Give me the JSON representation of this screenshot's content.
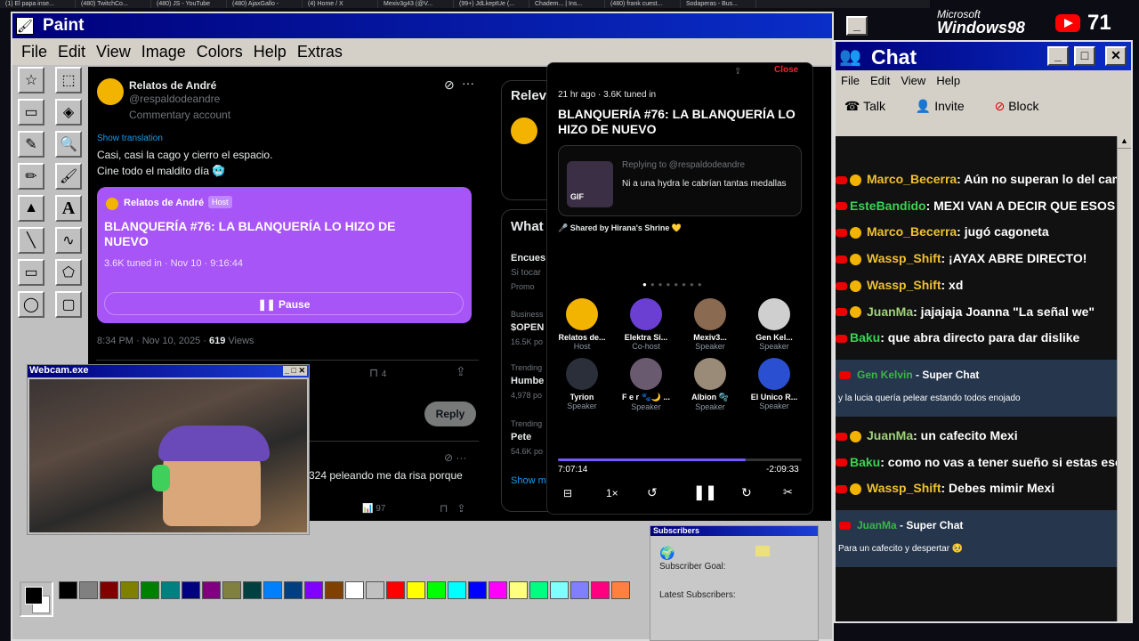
{
  "browser_tabs": [
    "(1) El papa inse...",
    "(480) TwitchCo...",
    "(480) JS - YouTube",
    "(480) AjaxGallo -",
    "(4) Home / X",
    "Mexiv3g43 (@V...",
    "(99+) JdLkeptUe (...",
    "Chadem... | Ins...",
    "(480) frank cuest...",
    "Sodaperas - Bus..."
  ],
  "paint": {
    "title": "Paint",
    "menu": [
      "File",
      "Edit",
      "View",
      "Image",
      "Colors",
      "Help",
      "Extras"
    ],
    "palette": [
      "#000000",
      "#808080",
      "#800000",
      "#808000",
      "#008000",
      "#008080",
      "#000080",
      "#800080",
      "#808040",
      "#004040",
      "#0080ff",
      "#004080",
      "#8000ff",
      "#804000",
      "#ffffff",
      "#c0c0c0",
      "#ff0000",
      "#ffff00",
      "#00ff00",
      "#00ffff",
      "#0000ff",
      "#ff00ff",
      "#ffff80",
      "#00ff80",
      "#80ffff",
      "#8080ff",
      "#ff0080",
      "#ff8040"
    ]
  },
  "tweet": {
    "author": "Relatos de André",
    "handle": "@respaldodeandre",
    "account_type": "Commentary account",
    "show_translation": "Show translation",
    "text_line1": "Casi, casi la cago y cierro el espacio.",
    "text_line2": "Cine todo el maldito día 🥶",
    "timestamp": "8:34 PM · Nov 10, 2025 · ",
    "views": "619",
    "views_label": " Views",
    "bookmarks": "4",
    "reply_label": "Reply",
    "reply_snippet": "324 peleando me da risa porque",
    "reply_views": "97"
  },
  "space_card": {
    "host_name": "Relatos de André",
    "host_badge": "Host",
    "title": "BLANQUERÍA #76: LA BLANQUERÍA LO HIZO DE NUEVO",
    "meta": "3.6K tuned in · Nov 10 · 9:16:44",
    "pause_label": "Pause"
  },
  "sidebar": {
    "relevant": "Relev",
    "whats": "What",
    "item1": "Encues",
    "item1b": "Si tocar",
    "item1c": "Promo",
    "item2": "Business",
    "item2b": "$OPEN",
    "item2c": "16.5K po",
    "item3": "Trending",
    "item3b": "Humbe",
    "item3c": "4,978 po",
    "item4": "Trending",
    "item4b": "Pete",
    "item4c": "54.6K po",
    "show_more": "Show m"
  },
  "space_overlay": {
    "close": "Close",
    "meta": "21 hr ago · 3.6K tuned in",
    "title": "BLANQUERÍA #76: LA BLANQUERÍA LO HIZO DE NUEVO",
    "replying_to": "Replying to @respaldodeandre",
    "reply_text": "Ni a una hydra le cabrían tantas medallas",
    "gif": "GIF",
    "shared_by": "Shared by Hirana's Shrine 💛",
    "speakers": [
      {
        "name": "Relatos de...",
        "role": "Host",
        "color": "#f2b400"
      },
      {
        "name": "Elektra Si...",
        "role": "Co-host",
        "color": "#6b3fd1"
      },
      {
        "name": "Mexiv3...",
        "role": "Speaker",
        "color": "#8a6a50"
      },
      {
        "name": "Gen Kel...",
        "role": "Speaker",
        "color": "#cfcfcf"
      },
      {
        "name": "Tyrion",
        "role": "Speaker",
        "color": "#2a2f3a"
      },
      {
        "name": "F e r 🐾🌙 ...",
        "role": "Speaker",
        "color": "#6a5a70"
      },
      {
        "name": "Albion 🫧",
        "role": "Speaker",
        "color": "#9a8a78"
      },
      {
        "name": "El Unico R...",
        "role": "Speaker",
        "color": "#2a4fd0"
      }
    ],
    "elapsed": "7:07:14",
    "remaining": "-2:09:33",
    "progress": 0.77,
    "speed": "1×"
  },
  "webcam": {
    "title": "Webcam.exe"
  },
  "chat": {
    "title": "Chat",
    "menu": [
      "File",
      "Edit",
      "View",
      "Help"
    ],
    "talk": "Talk",
    "invite": "Invite",
    "block": "Block",
    "messages": [
      {
        "user": "Marco_Becerra",
        "color": "#f0c030",
        "text": ": Aún no superan lo del cam",
        "star": true
      },
      {
        "user": "EsteBandido",
        "color": "#39d353",
        "text": ": MEXI VAN A DECIR QUE ESOS P",
        "star": false
      },
      {
        "user": "Marco_Becerra",
        "color": "#f0c030",
        "text": ": jugó cagoneta",
        "star": true
      },
      {
        "user": "Wassp_Shift",
        "color": "#f0c030",
        "text": ": ¡AYAX ABRE DIRECTO!",
        "star": true
      },
      {
        "user": "Wassp_Shift",
        "color": "#f0c030",
        "text": ": xd",
        "star": true
      },
      {
        "user": "JuanMa",
        "color": "#a0d27a",
        "text": ": jajajaja Joanna \"La señal we\"",
        "star": true
      },
      {
        "user": "Baku",
        "color": "#39d353",
        "text": ": que abra directo para dar dislike",
        "star": false
      }
    ],
    "superchat1": {
      "user": "Gen Kelvin",
      "label": " - Super Chat",
      "text": "y la lucia quería pelear estando todos enojado"
    },
    "messages2": [
      {
        "user": "JuanMa",
        "color": "#a0d27a",
        "text": ": un cafecito Mexi",
        "star": true
      },
      {
        "user": "Baku",
        "color": "#39d353",
        "text": ": como no vas a tener sueño si estas esc",
        "star": false
      },
      {
        "user": "Wassp_Shift",
        "color": "#f0c030",
        "text": ": Debes mimir Mexi",
        "star": true
      }
    ],
    "superchat2": {
      "user": "JuanMa",
      "label": " - Super Chat",
      "text": "Para un cafecito y despertar 🥺"
    }
  },
  "subscribers": {
    "title": "Subscribers",
    "goal": "Subscriber Goal:",
    "latest": "Latest Subscribers:"
  },
  "branding": {
    "ms": "Microsoft",
    "win": "Windows98",
    "count": "71"
  }
}
